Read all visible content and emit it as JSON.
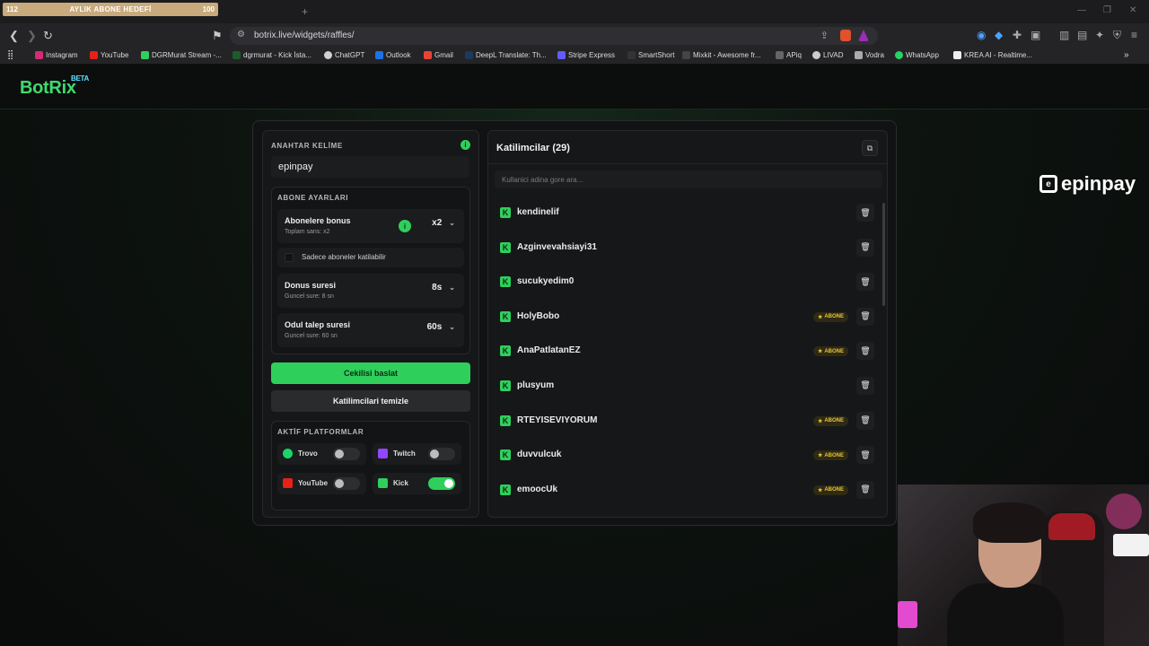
{
  "browser": {
    "tab_overlay": {
      "left": "112",
      "title": "AYLIK ABONE HEDEFİ",
      "right": "100"
    },
    "url": "botrix.live/widgets/raffles/",
    "bookmarks": [
      "Instagram",
      "YouTube",
      "DGRMurat Stream -...",
      "dgrmurat - Kick İsta...",
      "ChatGPT",
      "Outlook",
      "Gmail",
      "DeepL Translate: Th...",
      "Stripe Express",
      "SmartShort",
      "Mixkit - Awesome fr...",
      "APiq",
      "LIVAD",
      "Vodra",
      "WhatsApp",
      "KREA AI - Realtime..."
    ]
  },
  "brand": {
    "name": "BotRix",
    "tag": "BETA"
  },
  "settings": {
    "keyword_title": "ANAHTAR KELİME",
    "keyword_value": "epinpay",
    "sub_title": "ABONE AYARLARI",
    "bonus_label": "Abonelere bonus",
    "bonus_sub": "Toplam sans: x2",
    "bonus_value": "x2",
    "only_subs": "Sadece aboneler katilabilir",
    "spin_label": "Donus suresi",
    "spin_sub": "Guncel sure: 8 sn",
    "spin_value": "8s",
    "claim_label": "Odul talep suresi",
    "claim_sub": "Guncel sure: 60 sn",
    "claim_value": "60s",
    "start_button": "Cekilisi baslat",
    "clear_button": "Katilimcilari temizle",
    "platforms_title": "AKTİF PLATFORMLAR",
    "platforms": [
      {
        "name": "Trovo",
        "on": false
      },
      {
        "name": "Twitch",
        "on": false
      },
      {
        "name": "YouTube",
        "on": false
      },
      {
        "name": "Kick",
        "on": true
      }
    ]
  },
  "participants": {
    "title": "Katilimcilar (29)",
    "search_placeholder": "Kullanici adina gore ara...",
    "badge_label": "ABONE",
    "list": [
      {
        "name": "kendinelif",
        "sub": false
      },
      {
        "name": "Azginvevahsiayi31",
        "sub": false
      },
      {
        "name": "sucukyedim0",
        "sub": false
      },
      {
        "name": "HolyBobo",
        "sub": true
      },
      {
        "name": "AnaPatlatanEZ",
        "sub": true
      },
      {
        "name": "plusyum",
        "sub": false
      },
      {
        "name": "RTEYISEVIYORUM",
        "sub": true
      },
      {
        "name": "duvvulcuk",
        "sub": true
      },
      {
        "name": "emoocUk",
        "sub": true
      }
    ]
  },
  "overlay_brand": "epinpay",
  "colors": {
    "accent": "#2fcf5c",
    "badge": "#e9c537"
  }
}
